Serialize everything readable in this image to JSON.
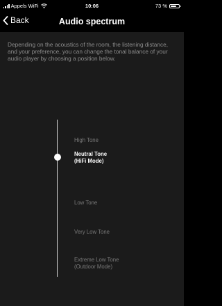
{
  "status_bar": {
    "carrier": "Appels WiFi",
    "time": "10:06",
    "battery": "73 %",
    "battery_level": 0.73,
    "icons": [
      "signal-icon",
      "wifi-icon",
      "battery-icon"
    ]
  },
  "nav": {
    "back_label": "Back",
    "title": "Audio spectrum"
  },
  "description": "Depending on the acoustics of the room, the listening distance, and your preference, you can change the tonal balance of your audio player by choosing a position below.",
  "tone": {
    "selected_index": 1,
    "options": [
      {
        "lines": [
          "High Tone"
        ]
      },
      {
        "lines": [
          "Neutral Tone",
          "(HiFi Mode)"
        ]
      },
      {
        "lines": [
          "Low Tone"
        ]
      },
      {
        "lines": [
          "Very Low Tone"
        ]
      },
      {
        "lines": [
          "Extreme Low Tone",
          "(Outdoor Mode)"
        ]
      }
    ]
  },
  "colors": {
    "background": "#000000",
    "content_background": "#1b1b1b",
    "muted_text": "#8c8c8c",
    "selected_text": "#ffffff"
  }
}
